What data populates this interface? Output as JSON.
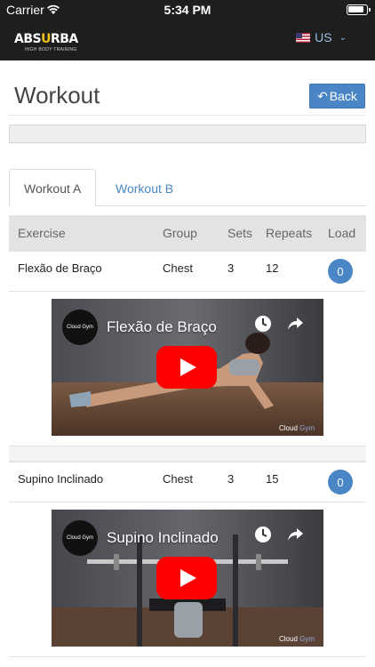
{
  "status": {
    "carrier": "Carrier",
    "time": "5:34 PM"
  },
  "header": {
    "logo_main_a": "ABS",
    "logo_main_b": "U",
    "logo_main_c": "RBA",
    "logo_tag": "HIGH BODY TRAINING",
    "locale": "US"
  },
  "page": {
    "title": "Workout",
    "back_label": "Back"
  },
  "tabs": [
    {
      "label": "Workout A",
      "active": true
    },
    {
      "label": "Workout B",
      "active": false
    }
  ],
  "table": {
    "columns": [
      "Exercise",
      "Group",
      "Sets",
      "Repeats",
      "Load"
    ],
    "rows": [
      {
        "exercise": "Flexão de Braço",
        "group": "Chest",
        "sets": "3",
        "repeats": "12",
        "load": "0",
        "video": {
          "channel": "Cloud Gym",
          "title": "Flexão de Braço",
          "watermark_a": "Cloud ",
          "watermark_b": "Gym"
        }
      },
      {
        "exercise": "Supino Inclinado",
        "group": "Chest",
        "sets": "3",
        "repeats": "15",
        "load": "0",
        "video": {
          "channel": "Cloud Gym",
          "title": "Supino Inclinado",
          "watermark_a": "Cloud ",
          "watermark_b": "Gym"
        }
      }
    ]
  },
  "colors": {
    "accent": "#4a86c5",
    "header_bg": "#1e1e1e",
    "youtube_red": "#ff0000"
  }
}
